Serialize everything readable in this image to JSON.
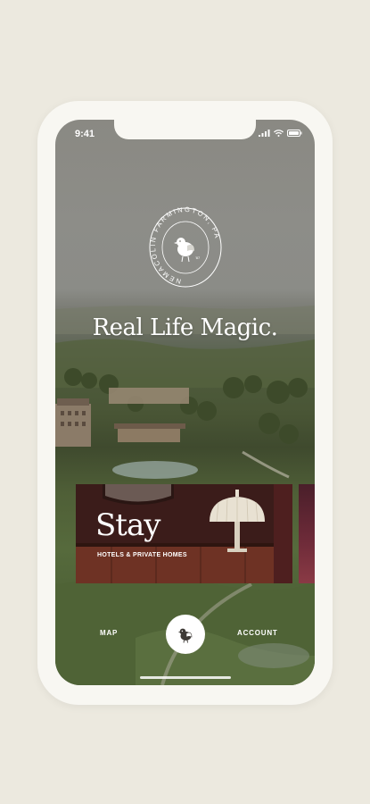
{
  "status_bar": {
    "time": "9:41",
    "icons": [
      "signal-icon",
      "wifi-icon",
      "battery-icon"
    ]
  },
  "logo": {
    "text": "NEMACOLIN FARMINGTON, PA"
  },
  "hero": {
    "tagline": "Real Life Magic."
  },
  "cards": [
    {
      "title": "Stay",
      "subtitle": "HOTELS & PRIVATE HOMES"
    }
  ],
  "bottom_nav": {
    "map_label": "MAP",
    "account_label": "ACCOUNT",
    "home_icon": "bird-icon"
  },
  "colors": {
    "background": "#ece9df",
    "device_frame": "#f8f7f2",
    "text_light": "#ffffff"
  }
}
